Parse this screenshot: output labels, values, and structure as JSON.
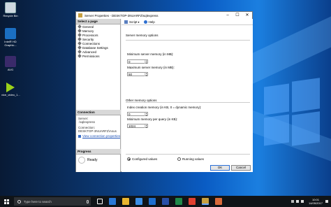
{
  "desktop": {
    "icons": [
      {
        "label": "Recycle Bin"
      },
      {
        "label": "Intel® HD Graphic..."
      },
      {
        "label": "AVG"
      },
      {
        "label": "vice_video_1..."
      }
    ]
  },
  "dialog": {
    "title": "Server Properties - DESKTOP-3NUARFZ\\sqlexpress",
    "select_page_header": "Select a page",
    "pages": [
      "General",
      "Memory",
      "Processors",
      "Security",
      "Connections",
      "Database Settings",
      "Advanced",
      "Permissions"
    ],
    "connection_header": "Connection",
    "server_label": "Server:",
    "server_value": ".\\sqlexpress",
    "connection_label": "Connection:",
    "connection_value": "DESKTOP-3NUARFZ\\Asus",
    "view_conn_link": "View connection properties",
    "progress_header": "Progress",
    "progress_status": "Ready",
    "toolbar": {
      "script": "Script",
      "help": "Help"
    },
    "server_memory_title": "Server memory options",
    "min_mem_label": "Minimum server memory (in MB):",
    "min_mem_value": "0",
    "max_mem_label": "Maximum server memory (in MB):",
    "max_mem_value": "50",
    "other_memory_title": "Other memory options",
    "index_mem_label": "Index creation memory (in KB, 0 = dynamic memory):",
    "index_mem_value": "0",
    "min_query_label": "Minimum memory per query (in KB):",
    "min_query_value": "1024",
    "radio_configured": "Configured values",
    "radio_running": "Running values",
    "ok_label": "OK",
    "cancel_label": "Cancel"
  },
  "taskbar": {
    "search_placeholder": "Type here to search",
    "time": "10:01",
    "date": "14/05/2017"
  }
}
